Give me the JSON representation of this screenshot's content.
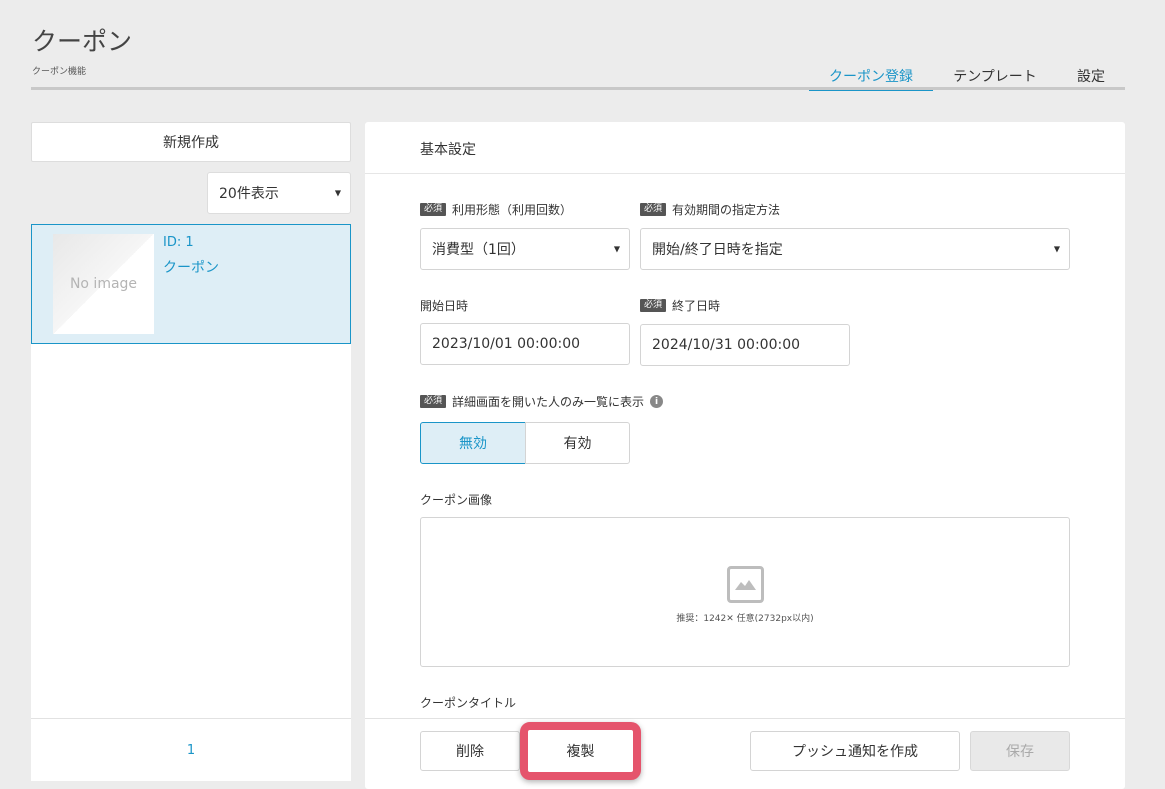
{
  "header": {
    "title": "クーポン",
    "subtitle": "クーポン機能",
    "tabs": [
      {
        "label": "クーポン登録",
        "active": true
      },
      {
        "label": "テンプレート",
        "active": false
      },
      {
        "label": "設定",
        "active": false
      }
    ]
  },
  "sidebar": {
    "new_button": "新規作成",
    "page_size": "20件表示",
    "items": [
      {
        "id_label": "ID: 1",
        "name": "クーポン",
        "thumb_text": "No image",
        "selected": true
      }
    ],
    "pager": {
      "current": "1"
    }
  },
  "form": {
    "section_title": "基本設定",
    "required_badge": "必須",
    "usage_type": {
      "label": "利用形態（利用回数）",
      "value": "消費型（1回）"
    },
    "period_method": {
      "label": "有効期間の指定方法",
      "value": "開始/終了日時を指定"
    },
    "start_datetime": {
      "label": "開始日時",
      "value": "2023/10/01 00:00:00"
    },
    "end_datetime": {
      "label": "終了日時",
      "value": "2024/10/31 00:00:00"
    },
    "detail_only": {
      "label": "詳細画面を開いた人のみ一覧に表示",
      "info_icon": "i",
      "options": [
        "無効",
        "有効"
      ],
      "selected": "無効"
    },
    "image": {
      "label": "クーポン画像",
      "hint": "推奨：1242✕ 任意(2732px以内)"
    },
    "title_label": "クーポンタイトル"
  },
  "footer": {
    "delete": "削除",
    "duplicate": "複製",
    "push": "プッシュ通知を作成",
    "save": "保存"
  },
  "colors": {
    "accent": "#1a95c8",
    "selected_bg": "#deeef6",
    "highlight": "#e5546c"
  }
}
